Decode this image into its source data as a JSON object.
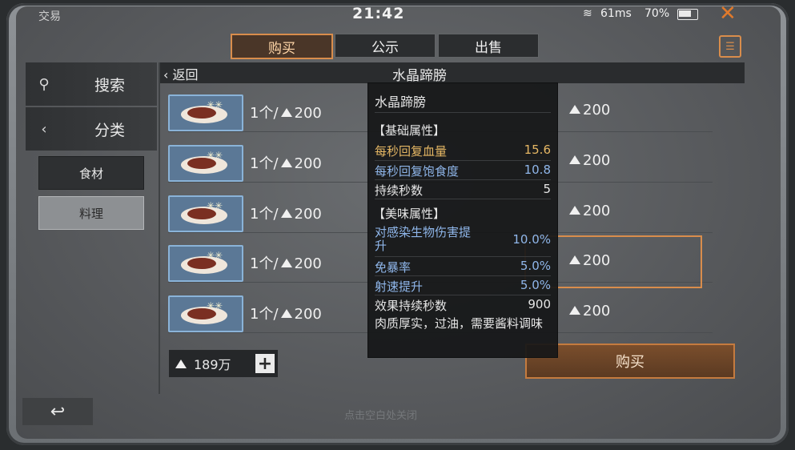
{
  "status_bar": {
    "app_title": "交易",
    "time": "21:42",
    "ping": "61ms",
    "battery": "70%",
    "close_icon": "close-icon",
    "wifi_icon": "wifi-icon",
    "battery_icon": "battery-icon",
    "accent_color": "#e07a2c"
  },
  "tabs": [
    {
      "label": "购买",
      "active": true
    },
    {
      "label": "公示",
      "active": false
    },
    {
      "label": "出售",
      "active": false
    }
  ],
  "sidebar": {
    "search_label": "搜索",
    "category_label": "分类",
    "categories": [
      {
        "label": "食材",
        "selected": false
      },
      {
        "label": "料理",
        "selected": true
      }
    ]
  },
  "header": {
    "back_label": "返回",
    "title": "水晶蹄膀"
  },
  "listings": [
    {
      "left": "1个/",
      "left_price": "200",
      "right_price": "200"
    },
    {
      "left": "1个/",
      "left_price": "200",
      "right_price": "200"
    },
    {
      "left": "1个/",
      "left_price": "200",
      "right_price": "200"
    },
    {
      "left": "1个/",
      "left_price": "200",
      "right_price": "200"
    },
    {
      "left": "1个/",
      "left_price": "200",
      "right_price": "200"
    }
  ],
  "balance": {
    "amount": "189万",
    "plus_label": "+"
  },
  "buy_button": "购买",
  "bottom_hint": "点击空白处关闭",
  "tooltip": {
    "name": "水晶蹄膀",
    "basic_header": "【基础属性】",
    "basic": [
      {
        "label": "每秒回复血量",
        "value": "15.6"
      },
      {
        "label": "每秒回复饱食度",
        "value": "10.8"
      },
      {
        "label": "持续秒数",
        "value": "5"
      }
    ],
    "flavor_header": "【美味属性】",
    "flavor": [
      {
        "label": "对感染生物伤害提升",
        "value": "10.0%"
      },
      {
        "label": "免暴率",
        "value": "5.0%"
      },
      {
        "label": "射速提升",
        "value": "5.0%"
      },
      {
        "label": "效果持续秒数",
        "value": "900"
      }
    ],
    "description": "肉质厚实，过油，需要酱料调味"
  }
}
